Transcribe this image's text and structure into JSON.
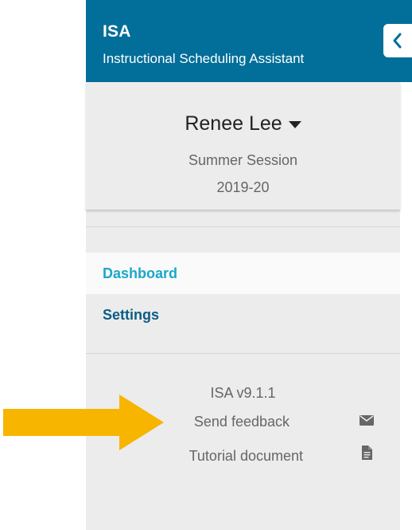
{
  "header": {
    "abbr": "ISA",
    "full_name": "Instructional Scheduling Assistant",
    "collapse_icon": "chevron-left-icon"
  },
  "user": {
    "name": "Renee Lee",
    "menu_icon": "caret-down-icon",
    "session": "Summer Session",
    "year": "2019-20"
  },
  "nav": {
    "items": [
      {
        "label": "Dashboard",
        "active": true
      },
      {
        "label": "Settings",
        "active": false
      }
    ]
  },
  "footer": {
    "version": "ISA v9.1.1",
    "feedback_label": "Send feedback",
    "feedback_icon": "envelope-icon",
    "tutorial_label": "Tutorial document",
    "tutorial_icon": "document-icon"
  },
  "annotation": {
    "arrow_color": "#f7b500"
  },
  "colors": {
    "header_bg": "#026e9a",
    "sidebar_bg": "#ececec",
    "active_link": "#1aa7c9",
    "link": "#0c5c86"
  }
}
